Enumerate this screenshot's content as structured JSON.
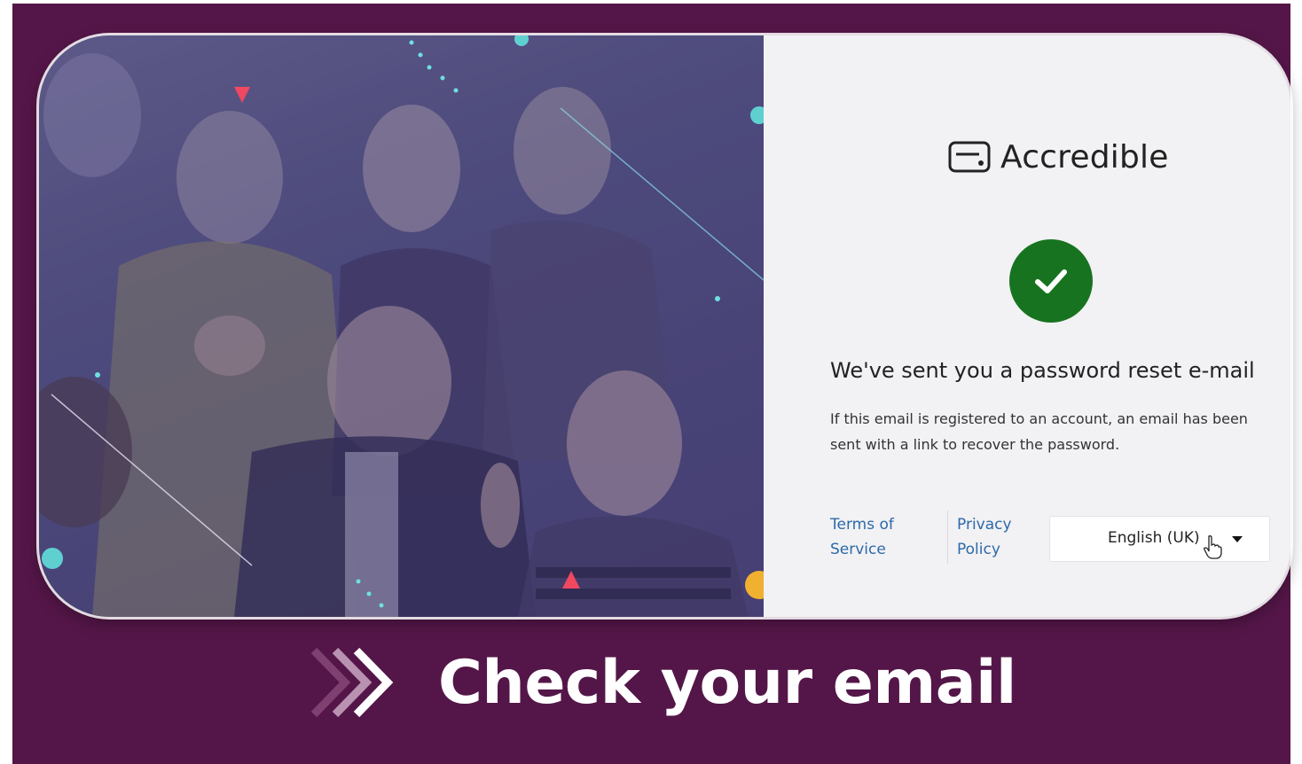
{
  "brand": {
    "name": "Accredible",
    "icon": "credential-card-icon"
  },
  "status_icon": "checkmark-icon",
  "colors": {
    "background": "#541648",
    "success": "#17731f",
    "link": "#2c6aa8",
    "panel": "#f2f1f4"
  },
  "confirmation": {
    "heading": "We've sent you a password reset e-mail",
    "message": "If this email is registered to an account, an email has been sent with a link to recover the password."
  },
  "footer": {
    "terms_line1": "Terms of",
    "terms_line2": "Service",
    "privacy_line1": "Privacy",
    "privacy_line2": "Policy",
    "language": "English (UK)"
  },
  "caption": {
    "text": "Check your email"
  }
}
